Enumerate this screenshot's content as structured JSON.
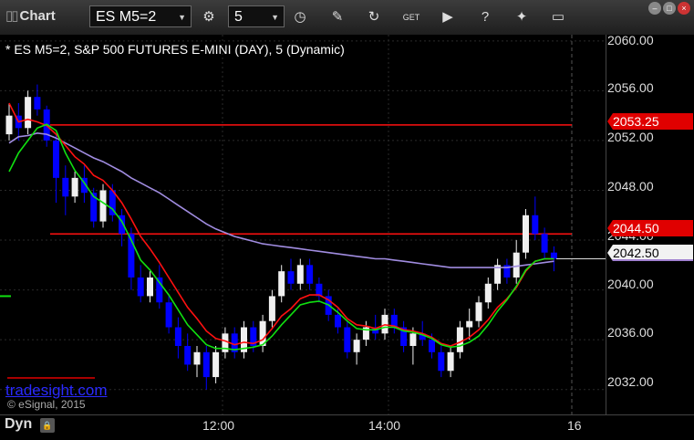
{
  "toolbar": {
    "title": "Chart",
    "symbol": "ES M5=2",
    "interval": "5",
    "icons": [
      "settings-icon",
      "clock-icon",
      "pencil-icon",
      "refresh-icon",
      "get-icon",
      "play-icon",
      "help-icon",
      "tools-icon",
      "comment-icon"
    ]
  },
  "chart": {
    "subtitle": "* ES M5=2, S&P 500 FUTURES E-MINI (DAY), 5 (Dynamic)",
    "watermark": "tradesight.com",
    "copyright": "© eSignal, 2015",
    "mode": "Dyn",
    "price_labels": {
      "red_high": "2053.25",
      "red_low": "2044.50",
      "last": "2042.50"
    },
    "colors": {
      "up": "#f0f0f0",
      "down": "#0000ff",
      "red": "#ff1010",
      "green": "#10e010",
      "purple": "#a08ce0"
    }
  },
  "chart_data": {
    "type": "candlestick",
    "y_ticks": [
      "2060.00",
      "2056.00",
      "2052.00",
      "2048.00",
      "2044.00",
      "2040.00",
      "2036.00",
      "2032.00"
    ],
    "x_ticks": [
      "12:00",
      "14:00",
      "16"
    ],
    "ylim": [
      2030.0,
      2060.5
    ],
    "levels": [
      2053.25,
      2044.5
    ],
    "last": 2042.5,
    "candles": [
      [
        2052.5,
        2055.0,
        2052.0,
        2054.0
      ],
      [
        2054.0,
        2055.0,
        2052.0,
        2053.0
      ],
      [
        2053.0,
        2056.0,
        2052.5,
        2055.5
      ],
      [
        2055.5,
        2056.5,
        2054.0,
        2054.5
      ],
      [
        2054.5,
        2054.8,
        2051.5,
        2052.0
      ],
      [
        2052.0,
        2052.5,
        2047.0,
        2049.0
      ],
      [
        2049.0,
        2050.0,
        2046.0,
        2047.5
      ],
      [
        2047.5,
        2049.5,
        2047.0,
        2049.0
      ],
      [
        2049.0,
        2050.0,
        2047.0,
        2047.8
      ],
      [
        2047.8,
        2048.2,
        2045.0,
        2045.5
      ],
      [
        2045.5,
        2048.5,
        2045.0,
        2048.0
      ],
      [
        2048.0,
        2048.5,
        2045.5,
        2046.0
      ],
      [
        2046.0,
        2046.5,
        2043.5,
        2044.5
      ],
      [
        2044.5,
        2045.0,
        2040.0,
        2041.0
      ],
      [
        2041.0,
        2042.0,
        2039.0,
        2039.5
      ],
      [
        2039.5,
        2041.5,
        2039.0,
        2041.0
      ],
      [
        2041.0,
        2042.0,
        2038.5,
        2039.0
      ],
      [
        2039.0,
        2039.5,
        2036.5,
        2037.0
      ],
      [
        2037.0,
        2037.8,
        2034.5,
        2035.5
      ],
      [
        2035.5,
        2036.5,
        2033.5,
        2034.0
      ],
      [
        2034.0,
        2035.5,
        2033.0,
        2035.0
      ],
      [
        2035.0,
        2035.5,
        2032.0,
        2033.0
      ],
      [
        2033.0,
        2035.5,
        2032.5,
        2035.0
      ],
      [
        2035.0,
        2037.0,
        2034.5,
        2036.5
      ],
      [
        2036.5,
        2037.0,
        2034.5,
        2035.0
      ],
      [
        2035.0,
        2037.5,
        2034.5,
        2037.0
      ],
      [
        2037.0,
        2037.5,
        2035.0,
        2035.5
      ],
      [
        2035.5,
        2038.0,
        2035.0,
        2037.5
      ],
      [
        2037.5,
        2040.0,
        2037.0,
        2039.5
      ],
      [
        2039.5,
        2042.0,
        2039.0,
        2041.5
      ],
      [
        2041.5,
        2042.5,
        2040.0,
        2040.5
      ],
      [
        2040.5,
        2042.5,
        2040.0,
        2042.0
      ],
      [
        2042.0,
        2042.5,
        2040.0,
        2040.5
      ],
      [
        2040.5,
        2041.0,
        2039.0,
        2039.5
      ],
      [
        2039.5,
        2040.0,
        2037.5,
        2038.0
      ],
      [
        2038.0,
        2038.5,
        2036.5,
        2037.0
      ],
      [
        2037.0,
        2037.5,
        2034.5,
        2035.0
      ],
      [
        2035.0,
        2036.5,
        2034.0,
        2036.0
      ],
      [
        2036.0,
        2037.5,
        2035.5,
        2037.0
      ],
      [
        2037.0,
        2038.0,
        2036.0,
        2036.5
      ],
      [
        2036.5,
        2038.5,
        2036.0,
        2038.0
      ],
      [
        2038.0,
        2038.5,
        2036.5,
        2037.0
      ],
      [
        2037.0,
        2037.5,
        2035.0,
        2035.5
      ],
      [
        2035.5,
        2037.0,
        2034.0,
        2036.5
      ],
      [
        2036.5,
        2037.5,
        2035.5,
        2036.0
      ],
      [
        2036.0,
        2036.5,
        2034.5,
        2035.0
      ],
      [
        2035.0,
        2035.5,
        2033.0,
        2033.5
      ],
      [
        2033.5,
        2035.5,
        2033.0,
        2035.0
      ],
      [
        2035.0,
        2037.5,
        2034.5,
        2037.0
      ],
      [
        2037.0,
        2038.5,
        2036.0,
        2037.5
      ],
      [
        2037.5,
        2039.5,
        2037.0,
        2039.0
      ],
      [
        2039.0,
        2041.0,
        2038.5,
        2040.5
      ],
      [
        2040.5,
        2042.5,
        2040.0,
        2042.0
      ],
      [
        2042.0,
        2042.5,
        2040.5,
        2041.0
      ],
      [
        2041.0,
        2044.0,
        2040.5,
        2043.0
      ],
      [
        2043.0,
        2046.5,
        2042.5,
        2046.0
      ],
      [
        2046.0,
        2047.5,
        2044.0,
        2044.5
      ],
      [
        2044.5,
        2045.0,
        2042.5,
        2043.0
      ],
      [
        2043.0,
        2043.5,
        2041.5,
        2042.5
      ]
    ],
    "ema_purple": [
      2051.8,
      2052.3,
      2052.4,
      2052.6,
      2052.5,
      2052.2,
      2051.8,
      2051.4,
      2051.0,
      2050.6,
      2050.3,
      2049.9,
      2049.5,
      2049.0,
      2048.6,
      2048.2,
      2047.8,
      2047.3,
      2046.8,
      2046.3,
      2045.8,
      2045.3,
      2044.9,
      2044.6,
      2044.3,
      2044.1,
      2043.9,
      2043.7,
      2043.6,
      2043.5,
      2043.4,
      2043.3,
      2043.2,
      2043.1,
      2043.0,
      2042.9,
      2042.8,
      2042.7,
      2042.6,
      2042.5,
      2042.5,
      2042.4,
      2042.3,
      2042.2,
      2042.1,
      2042.0,
      2041.9,
      2041.8,
      2041.8,
      2041.8,
      2041.8,
      2041.8,
      2041.8,
      2041.8,
      2041.9,
      2042.0,
      2042.1,
      2042.2,
      2042.3
    ],
    "ema_red": [
      2055.0,
      2053.5,
      2053.7,
      2053.5,
      2053.2,
      2052.5,
      2051.6,
      2050.7,
      2050.1,
      2049.2,
      2048.8,
      2048.0,
      2047.0,
      2045.7,
      2044.3,
      2043.3,
      2042.2,
      2041.0,
      2039.8,
      2038.6,
      2037.7,
      2036.7,
      2036.1,
      2035.9,
      2035.6,
      2035.8,
      2035.7,
      2036.0,
      2036.9,
      2037.9,
      2038.5,
      2039.3,
      2039.6,
      2039.6,
      2039.2,
      2038.6,
      2037.7,
      2037.2,
      2037.1,
      2036.9,
      2037.2,
      2037.1,
      2036.8,
      2036.7,
      2036.5,
      2036.2,
      2035.7,
      2035.5,
      2035.8,
      2036.2,
      2036.8,
      2037.6,
      2038.6,
      2039.3,
      2040.2,
      2041.5,
      2042.3,
      2042.5,
      2042.5
    ],
    "ema_green": [
      2049.5,
      2051.0,
      2052.0,
      2053.0,
      2053.3,
      2052.8,
      2051.0,
      2049.6,
      2048.6,
      2047.5,
      2047.0,
      2046.5,
      2045.5,
      2044.0,
      2042.4,
      2041.6,
      2040.6,
      2039.6,
      2038.4,
      2037.2,
      2036.4,
      2035.6,
      2035.3,
      2035.3,
      2035.2,
      2035.3,
      2035.4,
      2035.6,
      2036.3,
      2037.2,
      2038.0,
      2038.8,
      2039.0,
      2039.1,
      2038.8,
      2038.2,
      2037.5,
      2036.9,
      2036.8,
      2036.8,
      2037.0,
      2037.0,
      2036.7,
      2036.6,
      2036.4,
      2036.1,
      2035.6,
      2035.4,
      2035.5,
      2035.8,
      2036.3,
      2037.2,
      2038.3,
      2039.2,
      2040.3,
      2041.6,
      2042.3,
      2042.5,
      2042.5
    ],
    "grid": true
  }
}
